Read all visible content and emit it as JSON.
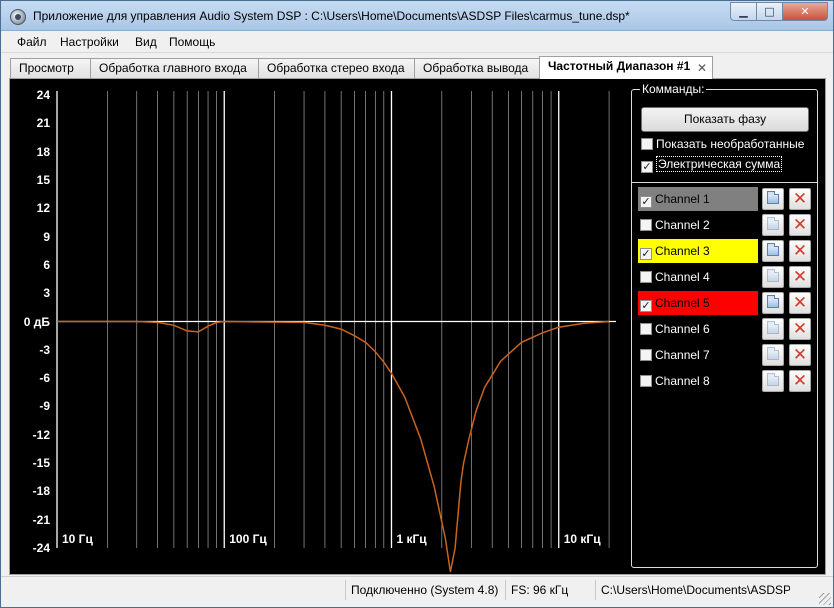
{
  "window": {
    "title": "Приложение для управления Audio System DSP : C:\\Users\\Home\\Documents\\ASDSP Files\\carmus_tune.dsp*"
  },
  "menu": [
    {
      "label": "Файл"
    },
    {
      "label": "Настройки"
    },
    {
      "label": "Вид"
    },
    {
      "label": "Помощь"
    }
  ],
  "tabs": [
    {
      "label": "Просмотр"
    },
    {
      "label": "Обработка главного входа"
    },
    {
      "label": "Обработка стерео входа"
    },
    {
      "label": "Обработка вывода"
    },
    {
      "label": "Частотный Диапазон #1",
      "active": true
    }
  ],
  "tab_close_glyph": "✕",
  "plot": {
    "y_labels": [
      "24",
      "21",
      "18",
      "15",
      "12",
      "9",
      "6",
      "3",
      "0 дБ",
      "-3",
      "-6",
      "-9",
      "-12",
      "-15",
      "-18",
      "-21",
      "-24"
    ],
    "x_labels": [
      "10 Гц",
      "100 Гц",
      "1 кГц",
      "10 кГц"
    ],
    "ylim": [
      -24,
      24
    ],
    "x_range_hz": [
      10,
      22000
    ],
    "x_scale": "log",
    "curve_color": "#c8641e",
    "grid_color": "#ffffff",
    "response": {
      "x": [
        10,
        30,
        40,
        50,
        60,
        70,
        80,
        90,
        100,
        300,
        400,
        500,
        600,
        700,
        800,
        900,
        1000,
        1200,
        1500,
        1800,
        2100,
        2250,
        2400,
        2600,
        2700,
        2900,
        3200,
        3600,
        4500,
        6000,
        8000,
        10000,
        14000,
        20000
      ],
      "y": [
        0,
        0,
        -0.1,
        -0.4,
        -1.0,
        -1.1,
        -0.5,
        -0.1,
        0,
        -0.1,
        -0.4,
        -0.8,
        -1.5,
        -2.2,
        -3.2,
        -4.3,
        -5.5,
        -8,
        -12.5,
        -17.5,
        -23,
        -27,
        -24,
        -17,
        -15,
        -12.5,
        -9.5,
        -7,
        -4.2,
        -2.2,
        -1.2,
        -0.6,
        -0.2,
        0
      ]
    }
  },
  "commands": {
    "group_title": "Комманды:",
    "show_phase_label": "Показать фазу",
    "show_raw": {
      "label": "Показать необработанные",
      "checked": false
    },
    "electrical_sum": {
      "label": "Электрическая сумма",
      "checked": true
    },
    "check_glyph": "✓",
    "delete_glyph": "✕"
  },
  "channels": [
    {
      "label": "Channel 1",
      "checked": true,
      "color": "#808080",
      "text_color": "#000000",
      "enabled": true
    },
    {
      "label": "Channel 2",
      "checked": false,
      "color": "#000000",
      "text_color": "#ffffff",
      "enabled": false
    },
    {
      "label": "Channel 3",
      "checked": true,
      "color": "#ffff00",
      "text_color": "#000000",
      "enabled": true
    },
    {
      "label": "Channel 4",
      "checked": false,
      "color": "#000000",
      "text_color": "#ffffff",
      "enabled": false
    },
    {
      "label": "Channel 5",
      "checked": true,
      "color": "#ff0000",
      "text_color": "#000000",
      "enabled": true
    },
    {
      "label": "Channel 6",
      "checked": false,
      "color": "#000000",
      "text_color": "#ffffff",
      "enabled": false
    },
    {
      "label": "Channel 7",
      "checked": false,
      "color": "#000000",
      "text_color": "#ffffff",
      "enabled": false
    },
    {
      "label": "Channel 8",
      "checked": false,
      "color": "#000000",
      "text_color": "#ffffff",
      "enabled": false
    }
  ],
  "status": {
    "connection": "Подключенно  (System 4.8)",
    "fs": "FS: 96 кГц",
    "path": "C:\\Users\\Home\\Documents\\ASDSP Files\\carmus_tune.dsp"
  }
}
